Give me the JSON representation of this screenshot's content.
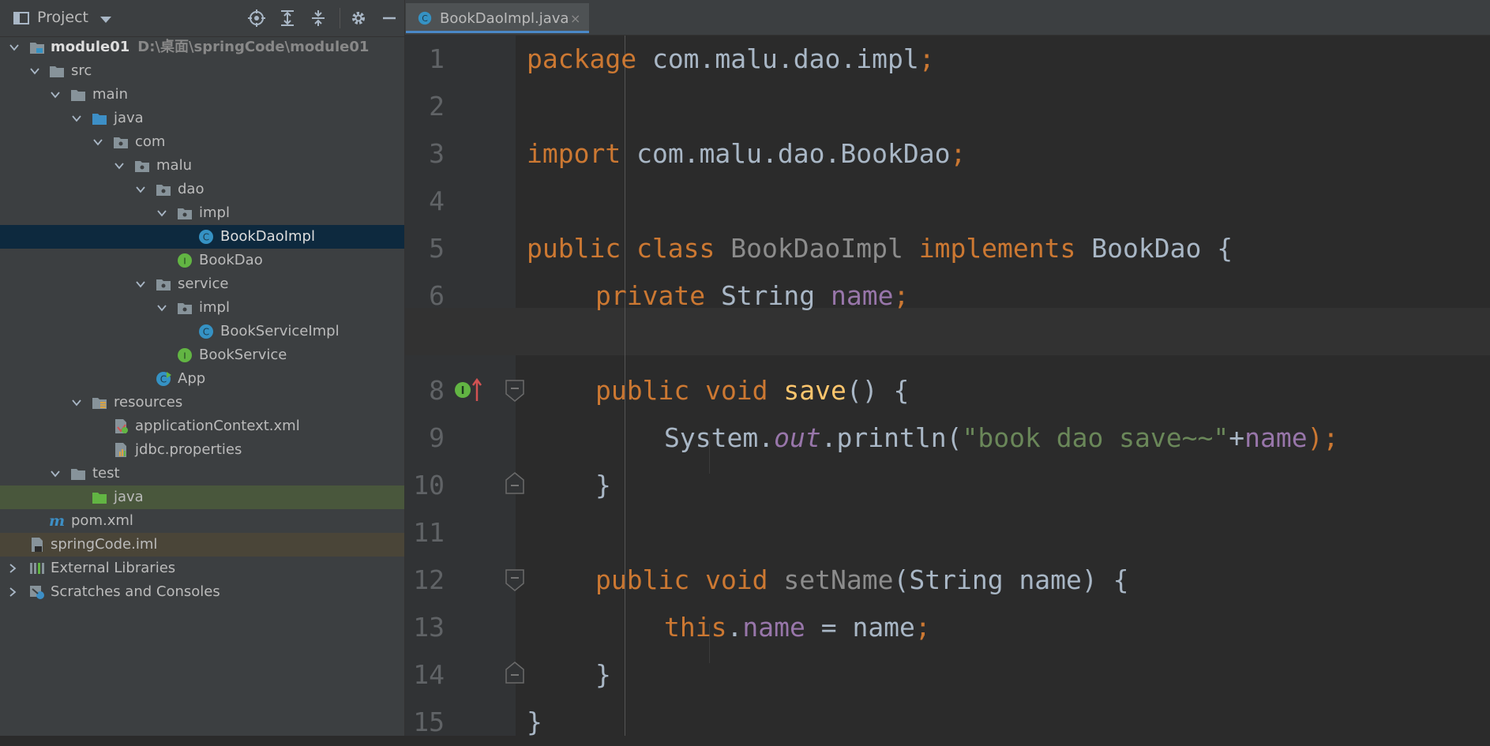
{
  "project_panel": {
    "title": "Project",
    "tree": [
      {
        "label": "module01",
        "path": "D:\\桌面\\springCode\\module01",
        "bold": true
      },
      {
        "label": "src"
      },
      {
        "label": "main"
      },
      {
        "label": "java"
      },
      {
        "label": "com"
      },
      {
        "label": "malu"
      },
      {
        "label": "dao"
      },
      {
        "label": "impl"
      },
      {
        "label": "BookDaoImpl"
      },
      {
        "label": "BookDao"
      },
      {
        "label": "service"
      },
      {
        "label": "impl"
      },
      {
        "label": "BookServiceImpl"
      },
      {
        "label": "BookService"
      },
      {
        "label": "App"
      },
      {
        "label": "resources"
      },
      {
        "label": "applicationContext.xml"
      },
      {
        "label": "jdbc.properties"
      },
      {
        "label": "test"
      },
      {
        "label": "java"
      },
      {
        "label": "pom.xml"
      },
      {
        "label": "springCode.iml"
      },
      {
        "label": "External Libraries"
      },
      {
        "label": "Scratches and Consoles"
      }
    ]
  },
  "editor": {
    "tab_label": "BookDaoImpl.java",
    "tab_close": "×",
    "current_line": 7,
    "lines": [
      {
        "n": "1"
      },
      {
        "n": "2"
      },
      {
        "n": "3"
      },
      {
        "n": "4"
      },
      {
        "n": "5"
      },
      {
        "n": "6"
      },
      {
        "n": "7"
      },
      {
        "n": "8"
      },
      {
        "n": "9"
      },
      {
        "n": "10"
      },
      {
        "n": "11"
      },
      {
        "n": "12"
      },
      {
        "n": "13"
      },
      {
        "n": "14"
      },
      {
        "n": "15"
      }
    ],
    "code": {
      "l1": [
        "package",
        " com.malu.dao.impl",
        ";"
      ],
      "l3": [
        "import",
        " com.malu.dao.BookDao",
        ";"
      ],
      "l5": [
        "public class",
        " BookDaoImpl",
        " implements",
        " BookDao {"
      ],
      "l6": [
        "private",
        " String ",
        "name",
        ";"
      ],
      "l8": [
        "public void",
        " save",
        "() {"
      ],
      "l9": [
        "System.",
        "out",
        ".println(",
        "\"book dao save~~\"",
        "+",
        "name",
        ");"
      ],
      "l10": [
        "}"
      ],
      "l12": [
        "public void",
        " setName",
        "(String name) {"
      ],
      "l13": [
        "this",
        ".",
        "name",
        " = name",
        ";"
      ],
      "l14": [
        "}"
      ],
      "l15": [
        "}"
      ]
    }
  },
  "colors": {
    "keyword": "#cc7832",
    "field": "#9876aa",
    "method": "#ffc66d",
    "string": "#6a8759",
    "plain": "#a9b7c6",
    "selection": "#0d293e"
  }
}
